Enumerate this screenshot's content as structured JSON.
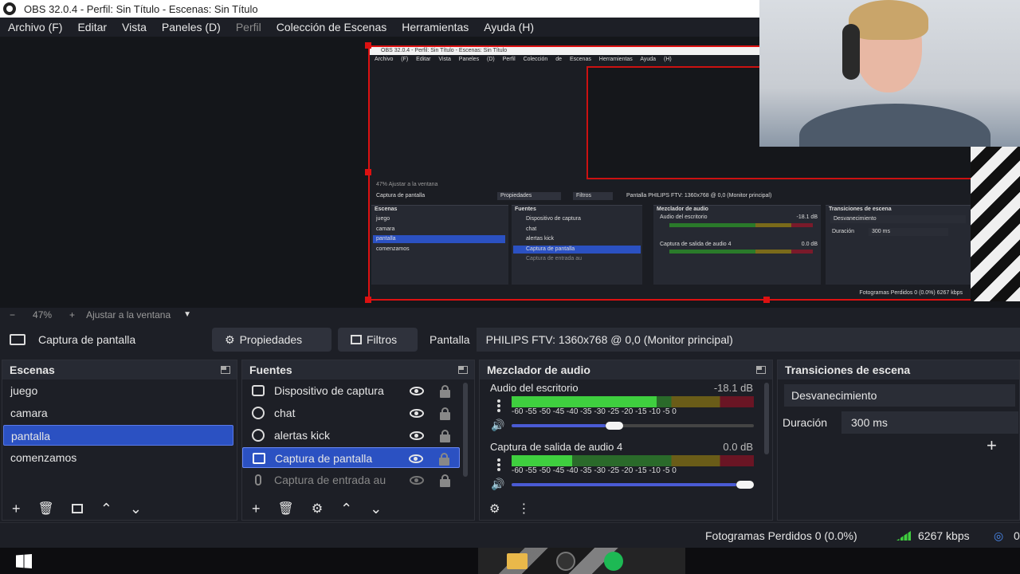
{
  "window": {
    "title": "OBS 32.0.4 - Perfil: Sin Título - Escenas: Sin Título"
  },
  "menu": [
    {
      "label": "Archivo (F)",
      "enabled": true
    },
    {
      "label": "Editar",
      "enabled": true
    },
    {
      "label": "Vista",
      "enabled": true
    },
    {
      "label": "Paneles (D)",
      "enabled": true
    },
    {
      "label": "Perfil",
      "enabled": false
    },
    {
      "label": "Colección de Escenas",
      "enabled": true
    },
    {
      "label": "Herramientas",
      "enabled": true
    },
    {
      "label": "Ayuda (H)",
      "enabled": true
    }
  ],
  "preview": {
    "mini": {
      "title": "OBS 32.0.4 - Perfil: Sin Título - Escenas: Sin Título",
      "menu": "Archivo (F) Editar Vista Paneles (D) Perfil Colección de Escenas Herramientas Ayuda (H)",
      "zoom": "47%   Ajustar a la ventana",
      "source_toolbar": "Captura de pantalla",
      "props": "Propiedades",
      "filters": "Filtros",
      "display": "Pantalla   PHILIPS FTV: 1360x768 @ 0,0 (Monitor principal)",
      "scenes_title": "Escenas",
      "scenes": [
        "juego",
        "camara",
        "pantalla",
        "comenzamos"
      ],
      "sources_title": "Fuentes",
      "sources": [
        "Dispositivo de captura",
        "chat",
        "alertas kick",
        "Captura de pantalla",
        "Captura de entrada au"
      ],
      "mixer_title": "Mezclador de audio",
      "mixer": [
        "Audio del escritorio",
        "Captura de salida de audio 4"
      ],
      "mixer_db": [
        "-18.1 dB",
        "0.0 dB"
      ],
      "transitions_title": "Transiciones de escena",
      "transition": "Desvanecimiento",
      "duration_label": "Duración",
      "duration": "300 ms",
      "status": "Fotogramas Perdidos 0 (0.0%)    6267 kbps"
    }
  },
  "zoom": {
    "minus": "−",
    "value": "47%",
    "plus": "+",
    "fit": "Ajustar a la ventana"
  },
  "source_toolbar": {
    "source_name": "Captura de pantalla",
    "properties": "Propiedades",
    "filters": "Filtros",
    "display_label": "Pantalla",
    "display_value": "PHILIPS FTV: 1360x768 @ 0,0 (Monitor principal)"
  },
  "scenes": {
    "title": "Escenas",
    "items": [
      {
        "label": "juego",
        "selected": false
      },
      {
        "label": "camara",
        "selected": false
      },
      {
        "label": "pantalla",
        "selected": true
      },
      {
        "label": "comenzamos",
        "selected": false
      }
    ]
  },
  "sources": {
    "title": "Fuentes",
    "items": [
      {
        "label": "Dispositivo de captura",
        "icon": "camera-icon",
        "visible": true,
        "selected": false
      },
      {
        "label": "chat",
        "icon": "globe-icon",
        "visible": true,
        "selected": false
      },
      {
        "label": "alertas kick",
        "icon": "globe-icon",
        "visible": true,
        "selected": false
      },
      {
        "label": "Captura de pantalla",
        "icon": "monitor-icon",
        "visible": true,
        "selected": true
      },
      {
        "label": "Captura de entrada au",
        "icon": "microphone-icon",
        "visible": false,
        "selected": false
      }
    ]
  },
  "mixer": {
    "title": "Mezclador de audio",
    "ticks": "-60 -55 -50 -45 -40 -35 -30 -25 -20 -15 -10  -5   0",
    "channels": [
      {
        "name": "Audio del escritorio",
        "db": "-18.1 dB",
        "level_fraction": 0.6,
        "volume_fraction": 0.42
      },
      {
        "name": "Captura de salida de audio 4",
        "db": "0.0 dB",
        "level_fraction": 0.25,
        "volume_fraction": 1.0
      }
    ]
  },
  "transitions": {
    "title": "Transiciones de escena",
    "selected": "Desvanecimiento",
    "duration_label": "Duración",
    "duration_value": "300 ms"
  },
  "status": {
    "dropped": "Fotogramas Perdidos 0 (0.0%)",
    "bitrate": "6267 kbps",
    "extra": "0"
  },
  "colors": {
    "selection": "#2b51c2",
    "record_red": "#dd1111",
    "meter_green": "#3fcf3f"
  }
}
